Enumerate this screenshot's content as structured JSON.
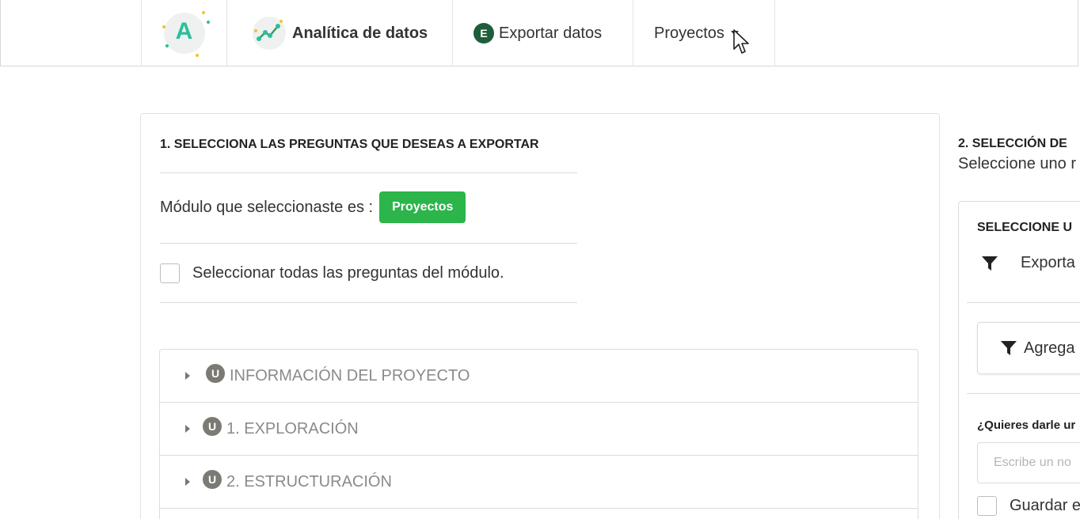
{
  "nav": {
    "logo_letter": "A",
    "analytics_label": "Analítica de datos",
    "export_icon_letter": "E",
    "export_label": "Exportar datos",
    "projects_label": "Proyectos"
  },
  "left": {
    "section_title": "1. SELECCIONA LAS PREGUNTAS QUE DESEAS A EXPORTAR",
    "module_prefix": "Módulo que seleccionaste es :",
    "module_badge": "Proyectos",
    "select_all_label": "Seleccionar todas las preguntas del módulo.",
    "accordion": [
      {
        "icon_letter": "U",
        "label": "INFORMACIÓN DEL PROYECTO"
      },
      {
        "icon_letter": "U",
        "label": "1. EXPLORACIÓN"
      },
      {
        "icon_letter": "U",
        "label": "2. ESTRUCTURACIÓN"
      }
    ]
  },
  "right": {
    "section_title": "2. SELECCIÓN DE",
    "subtitle": "Seleccione uno r",
    "card_title": "SELECCIONE U",
    "filter_label": "Exporta",
    "add_filter_label": "Agrega",
    "name_question": "¿Quieres darle ur",
    "name_placeholder": "Escribe un no",
    "save_label": "Guardar e"
  },
  "colors": {
    "badge_green": "#2bb54a",
    "logo_teal": "#2bbf9a",
    "export_icon_green": "#1e5e3a",
    "u_icon_gray": "#7b7b73"
  }
}
